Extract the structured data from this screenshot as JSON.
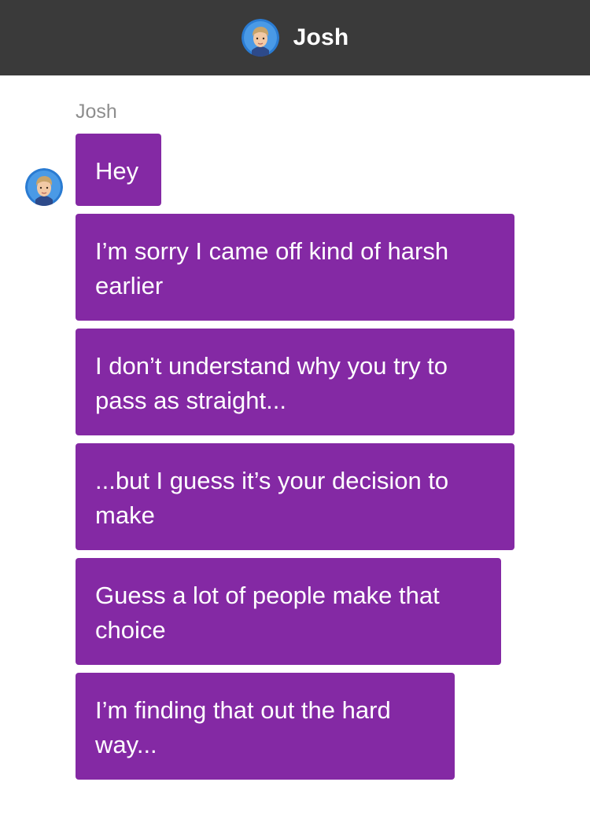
{
  "header": {
    "contact_name": "Josh",
    "avatar_icon": "avatar-josh-icon"
  },
  "thread": {
    "sender_name": "Josh",
    "bubble_color": "#8429a4",
    "messages": [
      {
        "text": "Hey"
      },
      {
        "text": "I’m sorry I came off kind of harsh earlier"
      },
      {
        "text": "I don’t understand why you try to pass as straight..."
      },
      {
        "text": "...but I guess it’s your decision to make"
      },
      {
        "text": "Guess a lot of people make that choice"
      },
      {
        "text": "I’m finding that out the hard way..."
      }
    ]
  }
}
